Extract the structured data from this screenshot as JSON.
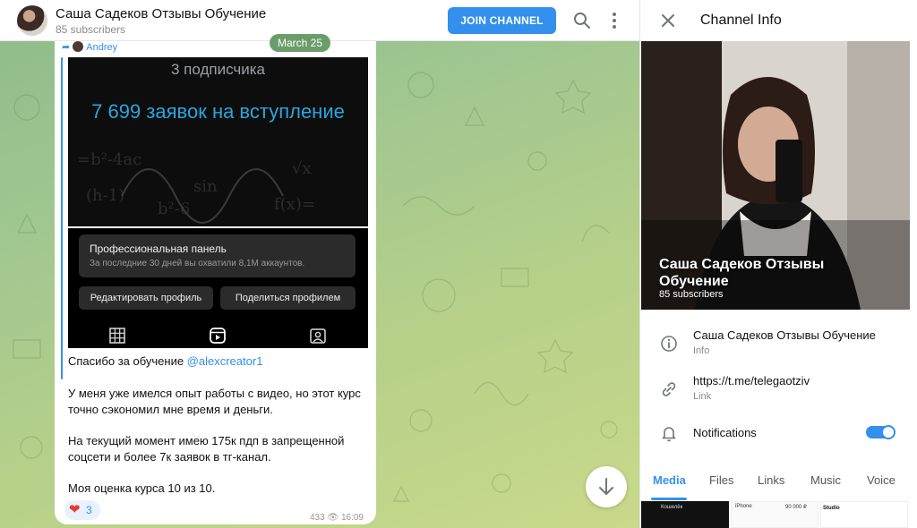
{
  "channel": {
    "title": "Саша Садеков Отзывы Обучение",
    "subscribers": "85 subscribers",
    "join_label": "JOIN CHANNEL"
  },
  "topbar_icons": [
    "search-icon",
    "more-vertical-icon"
  ],
  "post": {
    "forwarded_from": "Andrey",
    "date_badge": "March 25",
    "screenshot": {
      "subscribers_text": "3 подписчика",
      "requests_text": "7 699 заявок на вступление",
      "panel_title": "Профессиональная панель",
      "panel_subtitle": "За последние 30 дней вы охватили 8,1М аккаунтов.",
      "edit_profile": "Редактировать профиль",
      "share_profile": "Поделиться профилем"
    },
    "text_intro": "Спасибо за обучение ",
    "mention": "@alexcreator1",
    "paragraph_1": "У меня уже имелся опыт работы с видео, но этот курс точно сэкономил мне время и деньги.",
    "paragraph_2": "На текущий момент имею 175к пдп в запрещенной соцсети и более 7к заявок в тг-канал.",
    "paragraph_3": "Моя оценка курса 10 из 10.",
    "reaction_count": "3",
    "views": "433",
    "time": "16:09"
  },
  "info_panel": {
    "title": "Channel Info",
    "photo_title": "Саша Садеков Отзывы Обучение",
    "photo_subscribers": "85 subscribers",
    "info_value": "Саша Садеков Отзывы Обучение",
    "info_label": "Info",
    "link_value": "https://t.me/telegaotziv",
    "link_label": "Link",
    "notifications_label": "Notifications",
    "notifications_enabled": true
  },
  "media_tabs": [
    {
      "label": "Media",
      "active": true
    },
    {
      "label": "Files",
      "active": false
    },
    {
      "label": "Links",
      "active": false
    },
    {
      "label": "Music",
      "active": false
    },
    {
      "label": "Voice",
      "active": false
    }
  ],
  "thumbnails": [
    {
      "text": "Кошелёк"
    },
    {
      "text": "iPhone",
      "amount": "90 000 ₽"
    },
    {
      "text": "Studio"
    }
  ],
  "colors": {
    "accent": "#3390ec",
    "reaction_heart": "#e53935",
    "date_badge": "#508c50"
  }
}
